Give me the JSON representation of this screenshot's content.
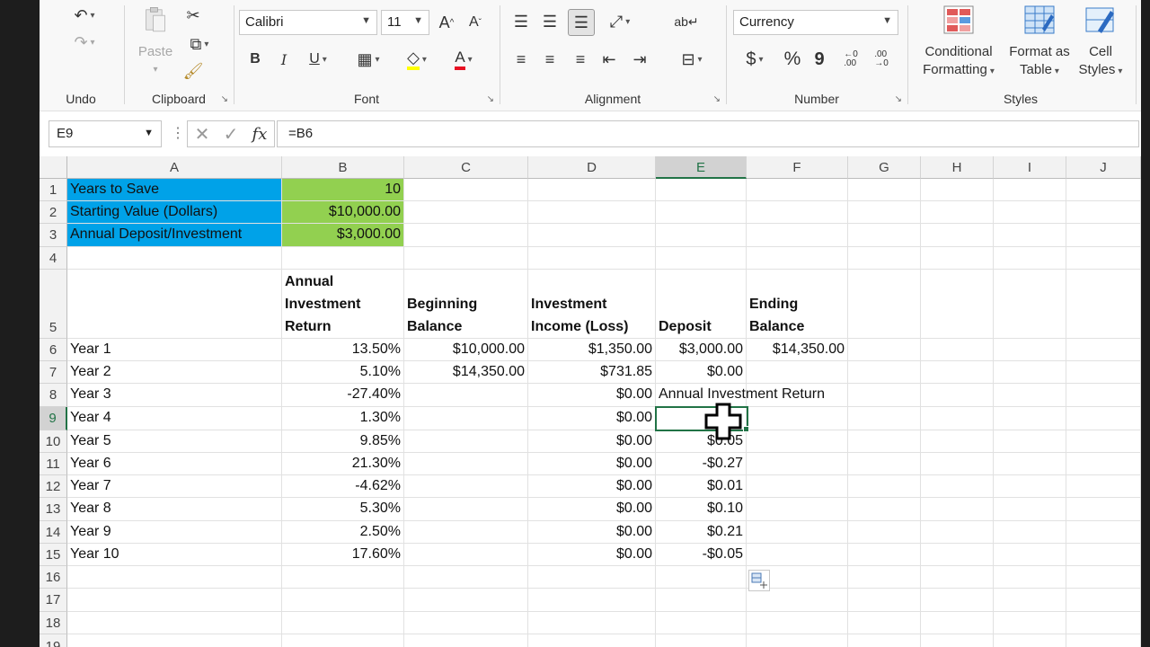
{
  "ribbon": {
    "groups": {
      "undo": "Undo",
      "clipboard": "Clipboard",
      "font": "Font",
      "alignment": "Alignment",
      "number": "Number",
      "styles": "Styles"
    },
    "paste_label": "Paste",
    "font_name": "Calibri",
    "font_size": "11",
    "number_format": "Currency",
    "bold": "B",
    "italic": "I",
    "underline": "U",
    "increase_font": "A",
    "decrease_font": "A",
    "currency_symbol": "$",
    "percent_symbol": "%",
    "comma_symbol": "9",
    "conditional_formatting": [
      "Conditional",
      "Formatting"
    ],
    "format_as_table": [
      "Format as",
      "Table"
    ],
    "cell_styles": [
      "Cell",
      "Styles"
    ]
  },
  "formula_bar": {
    "name_box": "E9",
    "formula": "=B6",
    "fx": "fx"
  },
  "grid": {
    "columns": [
      "A",
      "B",
      "C",
      "D",
      "E",
      "F",
      "G",
      "H",
      "I",
      "J"
    ],
    "rows": [
      "1",
      "2",
      "3",
      "4",
      "5",
      "6",
      "7",
      "8",
      "9",
      "10",
      "11",
      "12",
      "13",
      "14",
      "15",
      "16",
      "17",
      "18",
      "19"
    ],
    "active_cell": "E9",
    "inputs": {
      "a1": "Years to Save",
      "b1": "10",
      "a2": "Starting Value (Dollars)",
      "b2": "$10,000.00",
      "a3": "Annual Deposit/Investment",
      "b3": "$3,000.00"
    },
    "headers": {
      "b5": [
        "Annual",
        "Investment",
        "Return"
      ],
      "c5": [
        "Beginning",
        "Balance"
      ],
      "d5": [
        "Investment",
        "Income (Loss)"
      ],
      "e5": "Deposit",
      "f5": [
        "Ending",
        "Balance"
      ]
    },
    "data_rows": [
      {
        "label": "Year 1",
        "ret": "13.50%",
        "beg": "$10,000.00",
        "inc": "$1,350.00",
        "dep": "$3,000.00",
        "end": "$14,350.00"
      },
      {
        "label": "Year 2",
        "ret": "5.10%",
        "beg": "$14,350.00",
        "inc": "$731.85",
        "dep": "$0.00",
        "end": ""
      },
      {
        "label": "Year 3",
        "ret": "-27.40%",
        "beg": "",
        "inc": "$0.00",
        "dep": "Annual Investment Return",
        "end": ""
      },
      {
        "label": "Year 4",
        "ret": "1.30%",
        "beg": "",
        "inc": "$0.00",
        "dep": "",
        "end": ""
      },
      {
        "label": "Year 5",
        "ret": "9.85%",
        "beg": "",
        "inc": "$0.00",
        "dep": "$0.05",
        "end": ""
      },
      {
        "label": "Year 6",
        "ret": "21.30%",
        "beg": "",
        "inc": "$0.00",
        "dep": "-$0.27",
        "end": ""
      },
      {
        "label": "Year 7",
        "ret": "-4.62%",
        "beg": "",
        "inc": "$0.00",
        "dep": "$0.01",
        "end": ""
      },
      {
        "label": "Year 8",
        "ret": "5.30%",
        "beg": "",
        "inc": "$0.00",
        "dep": "$0.10",
        "end": ""
      },
      {
        "label": "Year 9",
        "ret": "2.50%",
        "beg": "",
        "inc": "$0.00",
        "dep": "$0.21",
        "end": ""
      },
      {
        "label": "Year 10",
        "ret": "17.60%",
        "beg": "",
        "inc": "$0.00",
        "dep": "-$0.05",
        "end": ""
      }
    ]
  },
  "colors": {
    "input_label_fill": "#00a2e8",
    "input_value_fill": "#92d050",
    "selection": "#217346"
  }
}
